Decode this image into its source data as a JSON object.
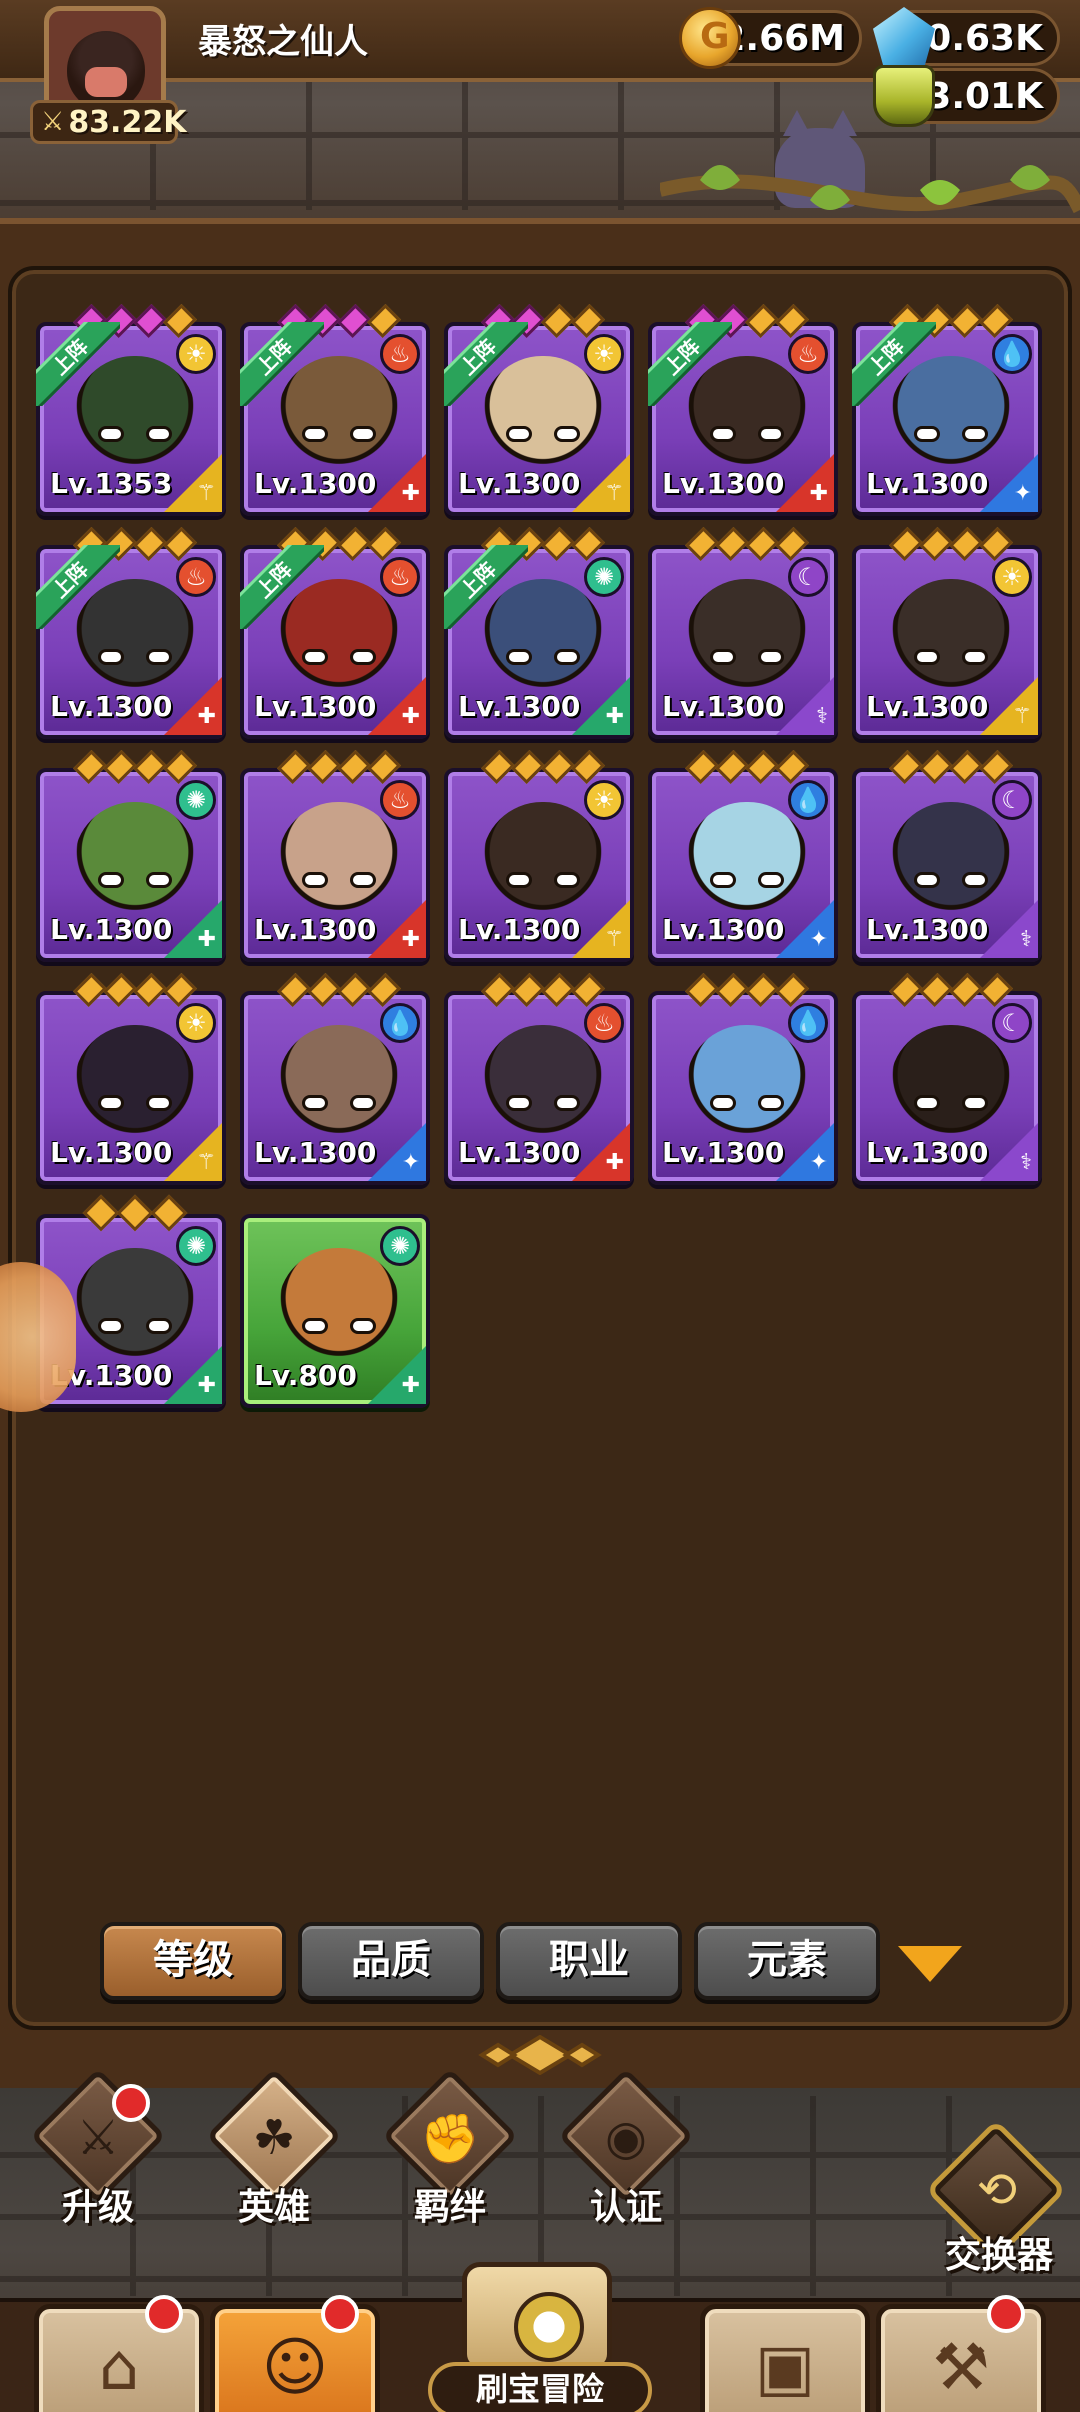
{
  "player": {
    "name": "暴怒之仙人",
    "power": "83.22K"
  },
  "resources": {
    "gold": "2.66M",
    "gems": "10.63K",
    "potions": "43.01K"
  },
  "heroes": [
    {
      "level": "Lv.1353",
      "on_team": true,
      "team_label": "上阵",
      "element": "light",
      "class_color": "yellow",
      "frame": "purple",
      "stars": [
        "pink",
        "pink",
        "pink",
        "gold"
      ]
    },
    {
      "level": "Lv.1300",
      "on_team": true,
      "team_label": "上阵",
      "element": "fire",
      "class_color": "red",
      "frame": "purple",
      "stars": [
        "pink",
        "pink",
        "pink",
        "gold"
      ]
    },
    {
      "level": "Lv.1300",
      "on_team": true,
      "team_label": "上阵",
      "element": "light",
      "class_color": "yellow",
      "frame": "purple",
      "stars": [
        "pink",
        "pink",
        "gold",
        "gold"
      ]
    },
    {
      "level": "Lv.1300",
      "on_team": true,
      "team_label": "上阵",
      "element": "fire",
      "class_color": "red",
      "frame": "purple",
      "stars": [
        "pink",
        "pink",
        "gold",
        "gold"
      ]
    },
    {
      "level": "Lv.1300",
      "on_team": true,
      "team_label": "上阵",
      "element": "water",
      "class_color": "blue",
      "frame": "purple",
      "stars": [
        "gold",
        "gold",
        "gold",
        "gold"
      ]
    },
    {
      "level": "Lv.1300",
      "on_team": true,
      "team_label": "上阵",
      "element": "fire",
      "class_color": "red",
      "frame": "purple",
      "stars": [
        "gold",
        "gold",
        "gold",
        "gold"
      ]
    },
    {
      "level": "Lv.1300",
      "on_team": true,
      "team_label": "上阵",
      "element": "fire",
      "class_color": "red",
      "frame": "purple",
      "stars": [
        "gold",
        "gold",
        "gold",
        "gold"
      ]
    },
    {
      "level": "Lv.1300",
      "on_team": true,
      "team_label": "上阵",
      "element": "wind",
      "class_color": "green",
      "frame": "purple",
      "stars": [
        "gold",
        "gold",
        "gold",
        "gold"
      ]
    },
    {
      "level": "Lv.1300",
      "on_team": false,
      "element": "dark",
      "class_color": "purple",
      "frame": "purple",
      "stars": [
        "gold",
        "gold",
        "gold",
        "gold"
      ]
    },
    {
      "level": "Lv.1300",
      "on_team": false,
      "element": "light",
      "class_color": "yellow",
      "frame": "purple",
      "stars": [
        "gold",
        "gold",
        "gold",
        "gold"
      ]
    },
    {
      "level": "Lv.1300",
      "on_team": false,
      "element": "wind",
      "class_color": "green",
      "frame": "purple",
      "stars": [
        "gold",
        "gold",
        "gold",
        "gold"
      ]
    },
    {
      "level": "Lv.1300",
      "on_team": false,
      "element": "fire",
      "class_color": "red",
      "frame": "purple",
      "stars": [
        "gold",
        "gold",
        "gold",
        "gold"
      ]
    },
    {
      "level": "Lv.1300",
      "on_team": false,
      "element": "light",
      "class_color": "yellow",
      "frame": "purple",
      "stars": [
        "gold",
        "gold",
        "gold",
        "gold"
      ]
    },
    {
      "level": "Lv.1300",
      "on_team": false,
      "element": "water",
      "class_color": "blue",
      "frame": "purple",
      "stars": [
        "gold",
        "gold",
        "gold",
        "gold"
      ]
    },
    {
      "level": "Lv.1300",
      "on_team": false,
      "element": "dark",
      "class_color": "purple",
      "frame": "purple",
      "stars": [
        "gold",
        "gold",
        "gold",
        "gold"
      ]
    },
    {
      "level": "Lv.1300",
      "on_team": false,
      "element": "light",
      "class_color": "yellow",
      "frame": "purple",
      "stars": [
        "gold",
        "gold",
        "gold",
        "gold"
      ]
    },
    {
      "level": "Lv.1300",
      "on_team": false,
      "element": "water",
      "class_color": "blue",
      "frame": "purple",
      "stars": [
        "gold",
        "gold",
        "gold",
        "gold"
      ]
    },
    {
      "level": "Lv.1300",
      "on_team": false,
      "element": "fire",
      "class_color": "red",
      "frame": "purple",
      "stars": [
        "gold",
        "gold",
        "gold",
        "gold"
      ]
    },
    {
      "level": "Lv.1300",
      "on_team": false,
      "element": "water",
      "class_color": "blue",
      "frame": "purple",
      "stars": [
        "gold",
        "gold",
        "gold",
        "gold"
      ]
    },
    {
      "level": "Lv.1300",
      "on_team": false,
      "element": "dark",
      "class_color": "purple",
      "frame": "purple",
      "stars": [
        "gold",
        "gold",
        "gold",
        "gold"
      ]
    },
    {
      "level": "Lv.1300",
      "on_team": false,
      "element": "wind",
      "class_color": "green",
      "frame": "purple",
      "stars": [
        "gold",
        "gold",
        "gold"
      ]
    },
    {
      "level": "Lv.800",
      "on_team": false,
      "element": "wind",
      "class_color": "green",
      "frame": "green",
      "stars": []
    }
  ],
  "sort_tabs": [
    {
      "label": "等级",
      "active": true
    },
    {
      "label": "品质",
      "active": false
    },
    {
      "label": "职业",
      "active": false
    },
    {
      "label": "元素",
      "active": false
    }
  ],
  "sub_menu": [
    {
      "label": "升级",
      "icon": "sword-icon",
      "badge": true,
      "active": false
    },
    {
      "label": "英雄",
      "icon": "hero-icon",
      "badge": false,
      "active": true
    },
    {
      "label": "羁绊",
      "icon": "fist-icon",
      "badge": false,
      "active": false
    },
    {
      "label": "认证",
      "icon": "eye-icon",
      "badge": false,
      "active": false
    }
  ],
  "exchanger": {
    "label": "交换器",
    "icon": "exchange-icon"
  },
  "bottom_nav": [
    {
      "icon": "shop-icon",
      "badge": true,
      "active": false
    },
    {
      "icon": "heroes-icon",
      "badge": true,
      "active": true
    },
    {
      "label": "刷宝冒险",
      "icon": "adventure-map-icon",
      "badge": false,
      "active": false
    },
    {
      "icon": "backpack-icon",
      "badge": false,
      "active": false
    },
    {
      "icon": "forge-icon",
      "badge": true,
      "active": false
    }
  ],
  "colors": {
    "panel_bg": "#3c2816",
    "card_purple": "#7a3fb8",
    "card_green": "#47a53a",
    "team_badge": "#2aa35a",
    "active_tab": "#9a5f2c",
    "inactive_tab": "#4d4d4d",
    "accent_orange": "#f2a51c"
  }
}
